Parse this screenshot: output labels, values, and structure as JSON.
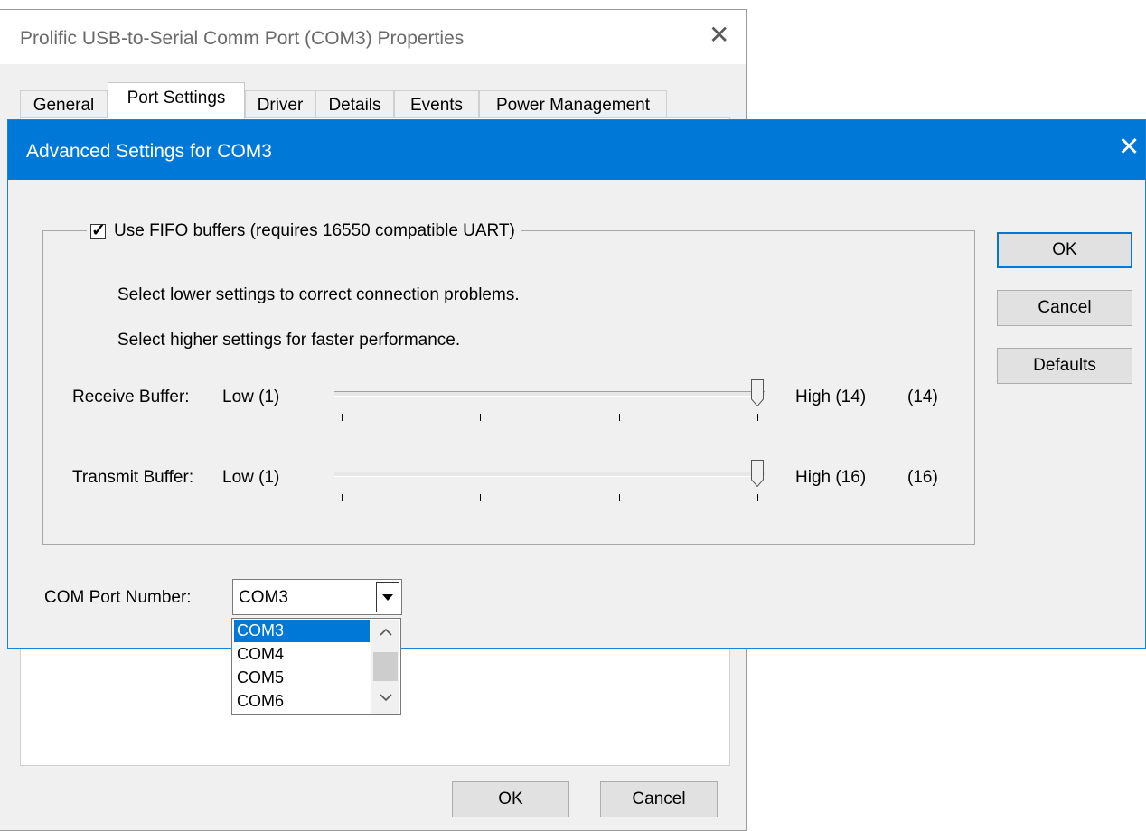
{
  "background_window": {
    "title": "Prolific USB-to-Serial Comm Port (COM3) Properties",
    "close_glyph": "✕",
    "tabs": [
      {
        "label": "General"
      },
      {
        "label": "Port Settings"
      },
      {
        "label": "Driver"
      },
      {
        "label": "Details"
      },
      {
        "label": "Events"
      },
      {
        "label": "Power Management"
      }
    ],
    "active_tab": "Port Settings",
    "ok_label": "OK",
    "cancel_label": "Cancel"
  },
  "dialog": {
    "title": "Advanced Settings for COM3",
    "close_glyph": "✕",
    "fifo_checkbox": {
      "label": "Use FIFO buffers (requires 16550 compatible UART)",
      "checked": true,
      "check_glyph": "✓"
    },
    "info_lower": "Select lower settings to correct connection problems.",
    "info_higher": "Select higher settings for faster performance.",
    "receive_buffer": {
      "label": "Receive Buffer:",
      "low": "Low (1)",
      "high": "High (14)",
      "value_text": "(14)",
      "value": 14,
      "min": 1,
      "max": 14
    },
    "transmit_buffer": {
      "label": "Transmit Buffer:",
      "low": "Low (1)",
      "high": "High (16)",
      "value_text": "(16)",
      "value": 16,
      "min": 1,
      "max": 16
    },
    "buttons": {
      "ok": "OK",
      "cancel": "Cancel",
      "defaults": "Defaults"
    },
    "com_port": {
      "label": "COM Port Number:",
      "selected": "COM3",
      "options": [
        "COM3",
        "COM4",
        "COM5",
        "COM6"
      ]
    }
  },
  "colors": {
    "accent": "#0078d7",
    "titlebar_text": "#ffffff",
    "window_bg": "#f0f0f0"
  }
}
